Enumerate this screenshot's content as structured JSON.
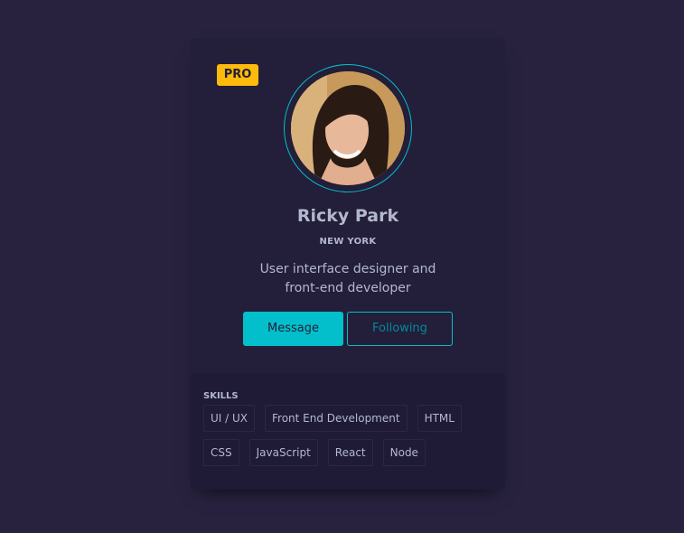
{
  "profile": {
    "badge": "PRO",
    "name": "Ricky Park",
    "location": "NEW YORK",
    "bio_line1": "User interface designer and",
    "bio_line2": "front-end developer",
    "avatar_icon": "user-avatar-photo"
  },
  "actions": {
    "message_label": "Message",
    "following_label": "Following"
  },
  "skills": {
    "title": "SKILLS",
    "items": [
      "UI / UX",
      "Front End Development",
      "HTML",
      "CSS",
      "JavaScript",
      "React",
      "Node"
    ]
  },
  "colors": {
    "background": "#28223f",
    "card": "#231e39",
    "accent": "#03bfcb",
    "badge": "#febb0b",
    "text": "#b3b8cd"
  }
}
